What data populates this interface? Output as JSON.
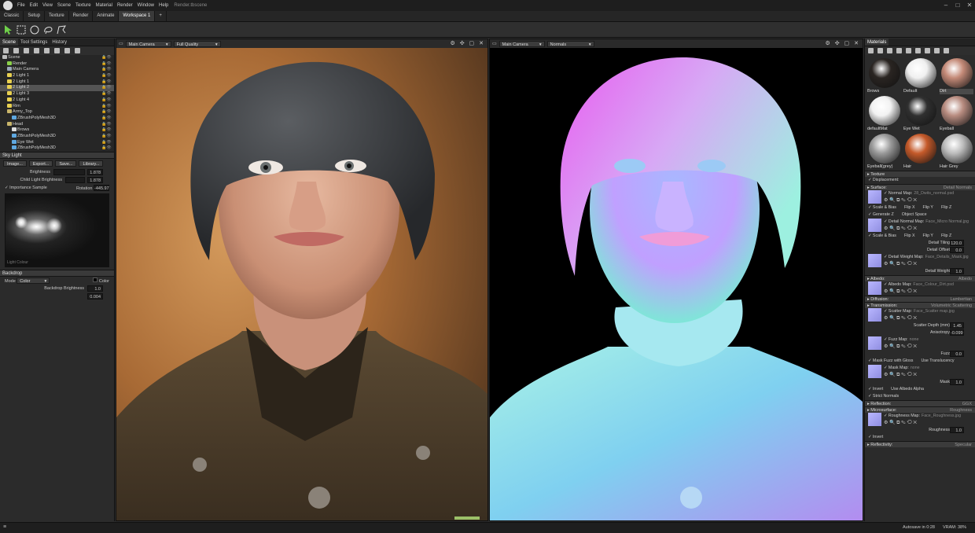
{
  "menubar": {
    "items": [
      "File",
      "Edit",
      "View",
      "Scene",
      "Texture",
      "Material",
      "Render",
      "Window",
      "Help"
    ],
    "title": "Render.tbscene",
    "controls": {
      "minimize": "–",
      "maximize": "□",
      "close": "✕"
    }
  },
  "workspace_tabs": [
    "Classic",
    "Setup",
    "Texture",
    "Render",
    "Animate",
    "Workspace 1",
    "+"
  ],
  "active_workspace": "Workspace 1",
  "left_panel": {
    "tabs": [
      "Scene",
      "Tool Settings",
      "History"
    ],
    "tree": [
      {
        "label": "Scene",
        "indent": 0,
        "icon": "scene-icon",
        "color": "#bdbdbd"
      },
      {
        "label": "Render",
        "indent": 1,
        "icon": "render-icon",
        "color": "#8ad04a"
      },
      {
        "label": "Main Camera",
        "indent": 1,
        "icon": "camera-icon",
        "color": "#9aa8b8"
      },
      {
        "label": "2 Light 1",
        "indent": 1,
        "icon": "light-icon",
        "color": "#e8d050"
      },
      {
        "label": "2 Light 1",
        "indent": 1,
        "icon": "light-icon",
        "color": "#e8d050"
      },
      {
        "label": "2 Light 2",
        "indent": 1,
        "icon": "light-icon",
        "color": "#e8d050"
      },
      {
        "label": "2 Light 3",
        "indent": 1,
        "icon": "light-icon",
        "color": "#e8d050"
      },
      {
        "label": "2 Light 4",
        "indent": 1,
        "icon": "light-icon",
        "color": "#e8d050"
      },
      {
        "label": "Rim",
        "indent": 1,
        "icon": "light-icon",
        "color": "#e8d050"
      },
      {
        "label": "Army_Top",
        "indent": 1,
        "icon": "folder-icon",
        "color": "#c9b56a"
      },
      {
        "label": "ZBrushPolyMesh3D",
        "indent": 2,
        "icon": "mesh-icon",
        "color": "#5fa8e0"
      },
      {
        "label": "Head",
        "indent": 1,
        "icon": "folder-icon",
        "color": "#c9b56a"
      },
      {
        "label": "Brows",
        "indent": 2,
        "icon": "mesh-icon",
        "color": "#dddddd"
      },
      {
        "label": "ZBrushPolyMesh3D",
        "indent": 2,
        "icon": "mesh-icon",
        "color": "#5fa8e0"
      },
      {
        "label": "Eye Wet",
        "indent": 2,
        "icon": "mesh-icon",
        "color": "#5fa8e0"
      },
      {
        "label": "ZBrushPolyMesh3D",
        "indent": 2,
        "icon": "mesh-icon",
        "color": "#5fa8e0"
      }
    ],
    "sky_light": {
      "header": "Sky Light",
      "buttons": [
        "Image...",
        "Export...",
        "Save...",
        "Library..."
      ],
      "brightness_label": "Brightness",
      "brightness": "1.878",
      "child_brightness_label": "Child Light Brightness",
      "child_brightness": "1.878",
      "importance_label": "Importance Sample",
      "rotation_label": "Rotation",
      "rotation": "-445.97",
      "hdri_caption": "Light Colour"
    },
    "backdrop": {
      "header": "Backdrop",
      "mode_label": "Mode",
      "mode_value": "Color",
      "color_label": "Color",
      "brightness_label": "Backdrop Brightness",
      "brightness": "1.0",
      "extra": "0.004"
    }
  },
  "viewport_left": {
    "camera": "Main Camera",
    "mode": "Full Quality"
  },
  "viewport_right": {
    "camera": "Main Camera",
    "mode": "Normals"
  },
  "right_panel": {
    "header": "Materials",
    "materials": [
      {
        "name": "Brows",
        "color": "#2a2522",
        "sel": false
      },
      {
        "name": "Default",
        "color": "#f0f0f0",
        "sel": false
      },
      {
        "name": "Dirt",
        "color": "#c48a78",
        "sel": true
      },
      {
        "name": "defaultMat",
        "color": "#f2f2f2",
        "sel": false
      },
      {
        "name": "Eye Wet",
        "color": "#303030",
        "sel": false
      },
      {
        "name": "Eyeball",
        "color": "#b88c80",
        "sel": false
      },
      {
        "name": "Eyeball(grey)",
        "color": "#9a9a9a",
        "sel": false
      },
      {
        "name": "Hair",
        "color": "#c55a2a",
        "sel": false
      },
      {
        "name": "Hair Grey",
        "color": "#bcbcbc",
        "sel": false
      }
    ],
    "texture_label": "Texture",
    "displacement_label": "Displacement:",
    "surface": {
      "label": "Surface:",
      "value": "Detail Normals"
    },
    "normal_map": {
      "label": "Normal Map:",
      "file": "28_Dwits_normal.psd"
    },
    "scale_bias": "Scale & Bias",
    "flip_x": "Flip X",
    "flip_y": "Flip Y",
    "flip_z": "Flip Z",
    "generate_z": "Generate Z",
    "object_space": "Object Space",
    "detail_normal": {
      "label": "Detail Normal Map:",
      "file": "Face_Micro Normal.jpg"
    },
    "uv_set": "UV Set",
    "uv_set_value": "0",
    "detail_tiling": {
      "label": "Detail Tiling",
      "value": "120.0"
    },
    "detail_offset": {
      "label": "Detail Offset",
      "value": "0.0"
    },
    "detail_weight_map": {
      "label": "Detail Weight Map:",
      "file": "Face_Details_Mask.jpg"
    },
    "channel": "Channel",
    "channel_value": "R",
    "detail_weight": {
      "label": "Detail Weight",
      "value": "1.0"
    },
    "albedo": {
      "label": "Albedo:",
      "value": "Albedo"
    },
    "albedo_map": {
      "label": "Albedo Map:",
      "file": "Face_Colour_Dirt.psd"
    },
    "color_label": "Color",
    "diffusion": {
      "label": "Diffusion:",
      "value": "Lambertian"
    },
    "transmission": {
      "label": "Transmission:",
      "value": "Volumetric Scattering"
    },
    "scatter_map": {
      "label": "Scatter Map:",
      "file": "Face_Scatter map.jpg"
    },
    "scatter_depth": {
      "label": "Scatter Depth (mm)",
      "value": "1.45"
    },
    "anisotropy": {
      "label": "Anisotropy",
      "value": "-0.099"
    },
    "fuzz_map": {
      "label": "Fuzz Map:",
      "file": "none"
    },
    "fuzz": {
      "label": "Fuzz",
      "value": "0.0"
    },
    "mask_fuzz": "Mask Fuzz with Gloss",
    "use_translucency": "Use Translucency",
    "mask_map": {
      "label": "Mask Map:",
      "file": "none"
    },
    "mask": {
      "label": "Mask",
      "value": "1.0"
    },
    "invert": "Invert",
    "use_albedo_alpha": "Use Albedo Alpha",
    "strict_normals": "Strict Normals",
    "reflection": {
      "label": "Reflection:",
      "value": "GGX"
    },
    "microsurface": {
      "label": "Microsurface:",
      "value": "Roughness"
    },
    "roughness_map": {
      "label": "Roughness Map:",
      "file": "Face_Roughness.jpg"
    },
    "roughness": {
      "label": "Roughness",
      "value": "1.0"
    },
    "invert2": "Invert",
    "reflectivity": {
      "label": "Reflectivity:",
      "value": "Specular"
    }
  },
  "status": {
    "autosave": "Autosave in 0:28",
    "vram": "VRAM: 38%"
  }
}
